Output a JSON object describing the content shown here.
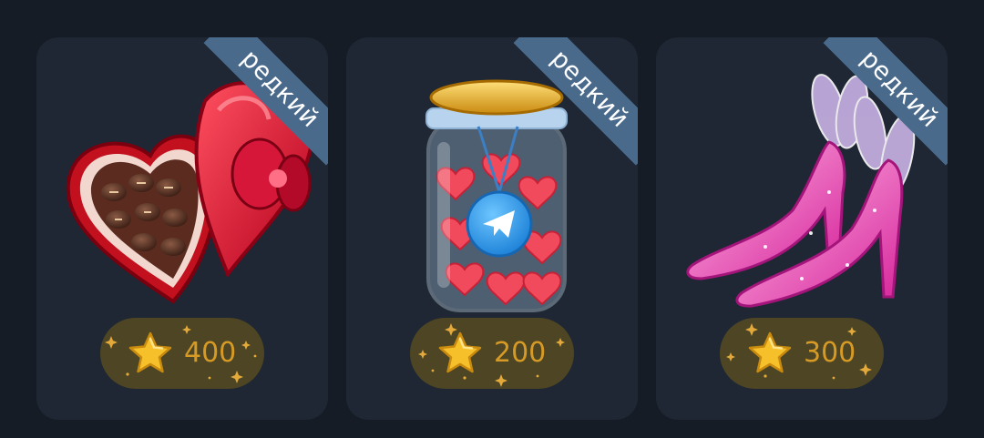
{
  "gifts": [
    {
      "badge": "редкий",
      "price": "400",
      "item_icon": "chocolate-heart-box-icon"
    },
    {
      "badge": "редкий",
      "price": "200",
      "item_icon": "jar-of-hearts-icon"
    },
    {
      "badge": "редкий",
      "price": "300",
      "item_icon": "high-heel-shoes-icon"
    }
  ],
  "colors": {
    "background": "#151c26",
    "card": "#1e2733",
    "ribbon": "#4a6a8c",
    "price_pill": "#4d4523",
    "price_text": "#d69a25",
    "star": "#f5c02a"
  }
}
